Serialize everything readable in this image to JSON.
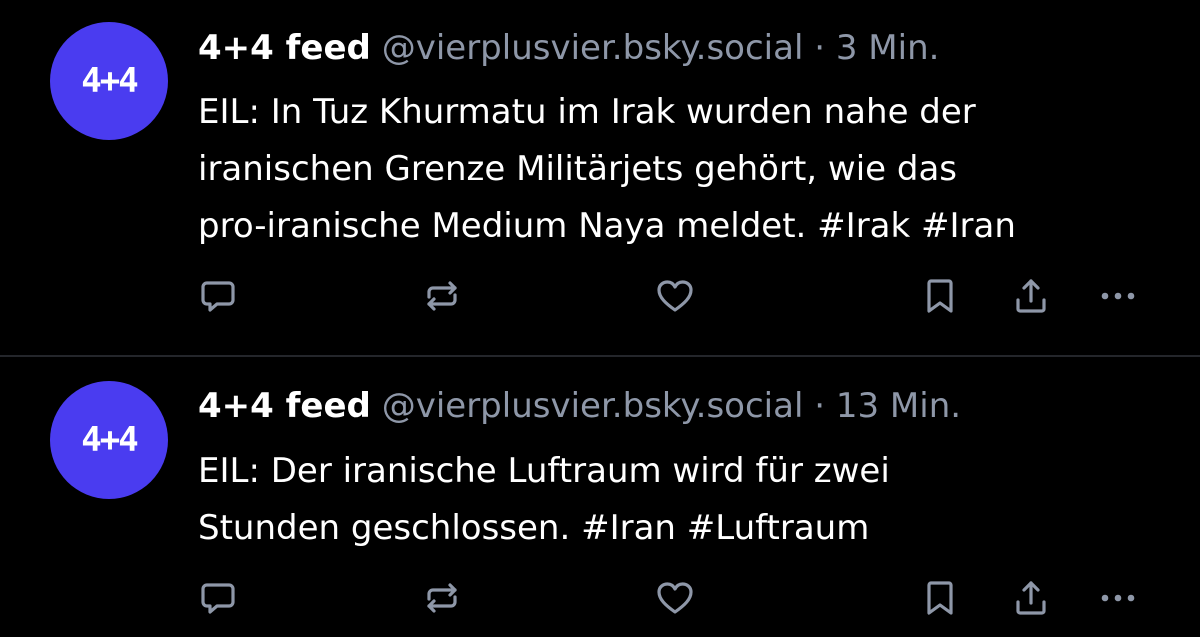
{
  "colors": {
    "background": "#000000",
    "avatar": "#4a3cf0",
    "text": "#ffffff",
    "muted": "#8e97a8",
    "divider": "#24262b"
  },
  "posts": [
    {
      "avatar_text": "4+4",
      "author": "4+4 feed",
      "handle": "@vierplusvier.bsky.social",
      "separator": "·",
      "time": "3 Min.",
      "lines": [
        "EIL: In Tuz Khurmatu im Irak wurden nahe der",
        "iranischen Grenze Militärjets gehört, wie das",
        "pro-iranische Medium Naya meldet. #Irak #Iran"
      ],
      "actions": [
        "reply-icon",
        "repost-icon",
        "like-icon",
        "bookmark-icon",
        "share-icon",
        "more-icon"
      ]
    },
    {
      "avatar_text": "4+4",
      "author": "4+4 feed",
      "handle": "@vierplusvier.bsky.social",
      "separator": "·",
      "time": "13 Min.",
      "lines": [
        "EIL: Der iranische Luftraum wird für zwei",
        "Stunden geschlossen. #Iran #Luftraum"
      ],
      "actions": [
        "reply-icon",
        "repost-icon",
        "like-icon",
        "bookmark-icon",
        "share-icon",
        "more-icon"
      ]
    }
  ]
}
